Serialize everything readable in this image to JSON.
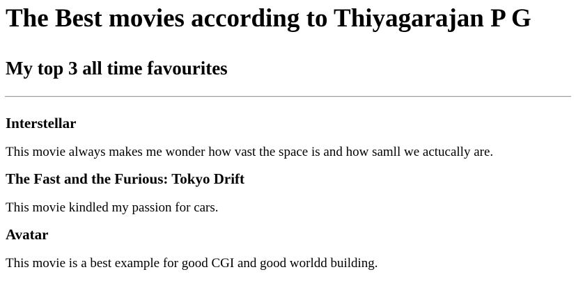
{
  "page": {
    "title": "The Best movies according to Thiyagarajan P G",
    "subtitle": "My top 3 all time favourites"
  },
  "movies": [
    {
      "name": "Interstellar",
      "description": "This movie always makes me wonder how vast the space is and how samll we actucally are."
    },
    {
      "name": "The Fast and the Furious: Tokyo Drift",
      "description": "This movie kindled my passion for cars."
    },
    {
      "name": "Avatar",
      "description": "This movie is a best example for good CGI and good worldd building."
    }
  ]
}
